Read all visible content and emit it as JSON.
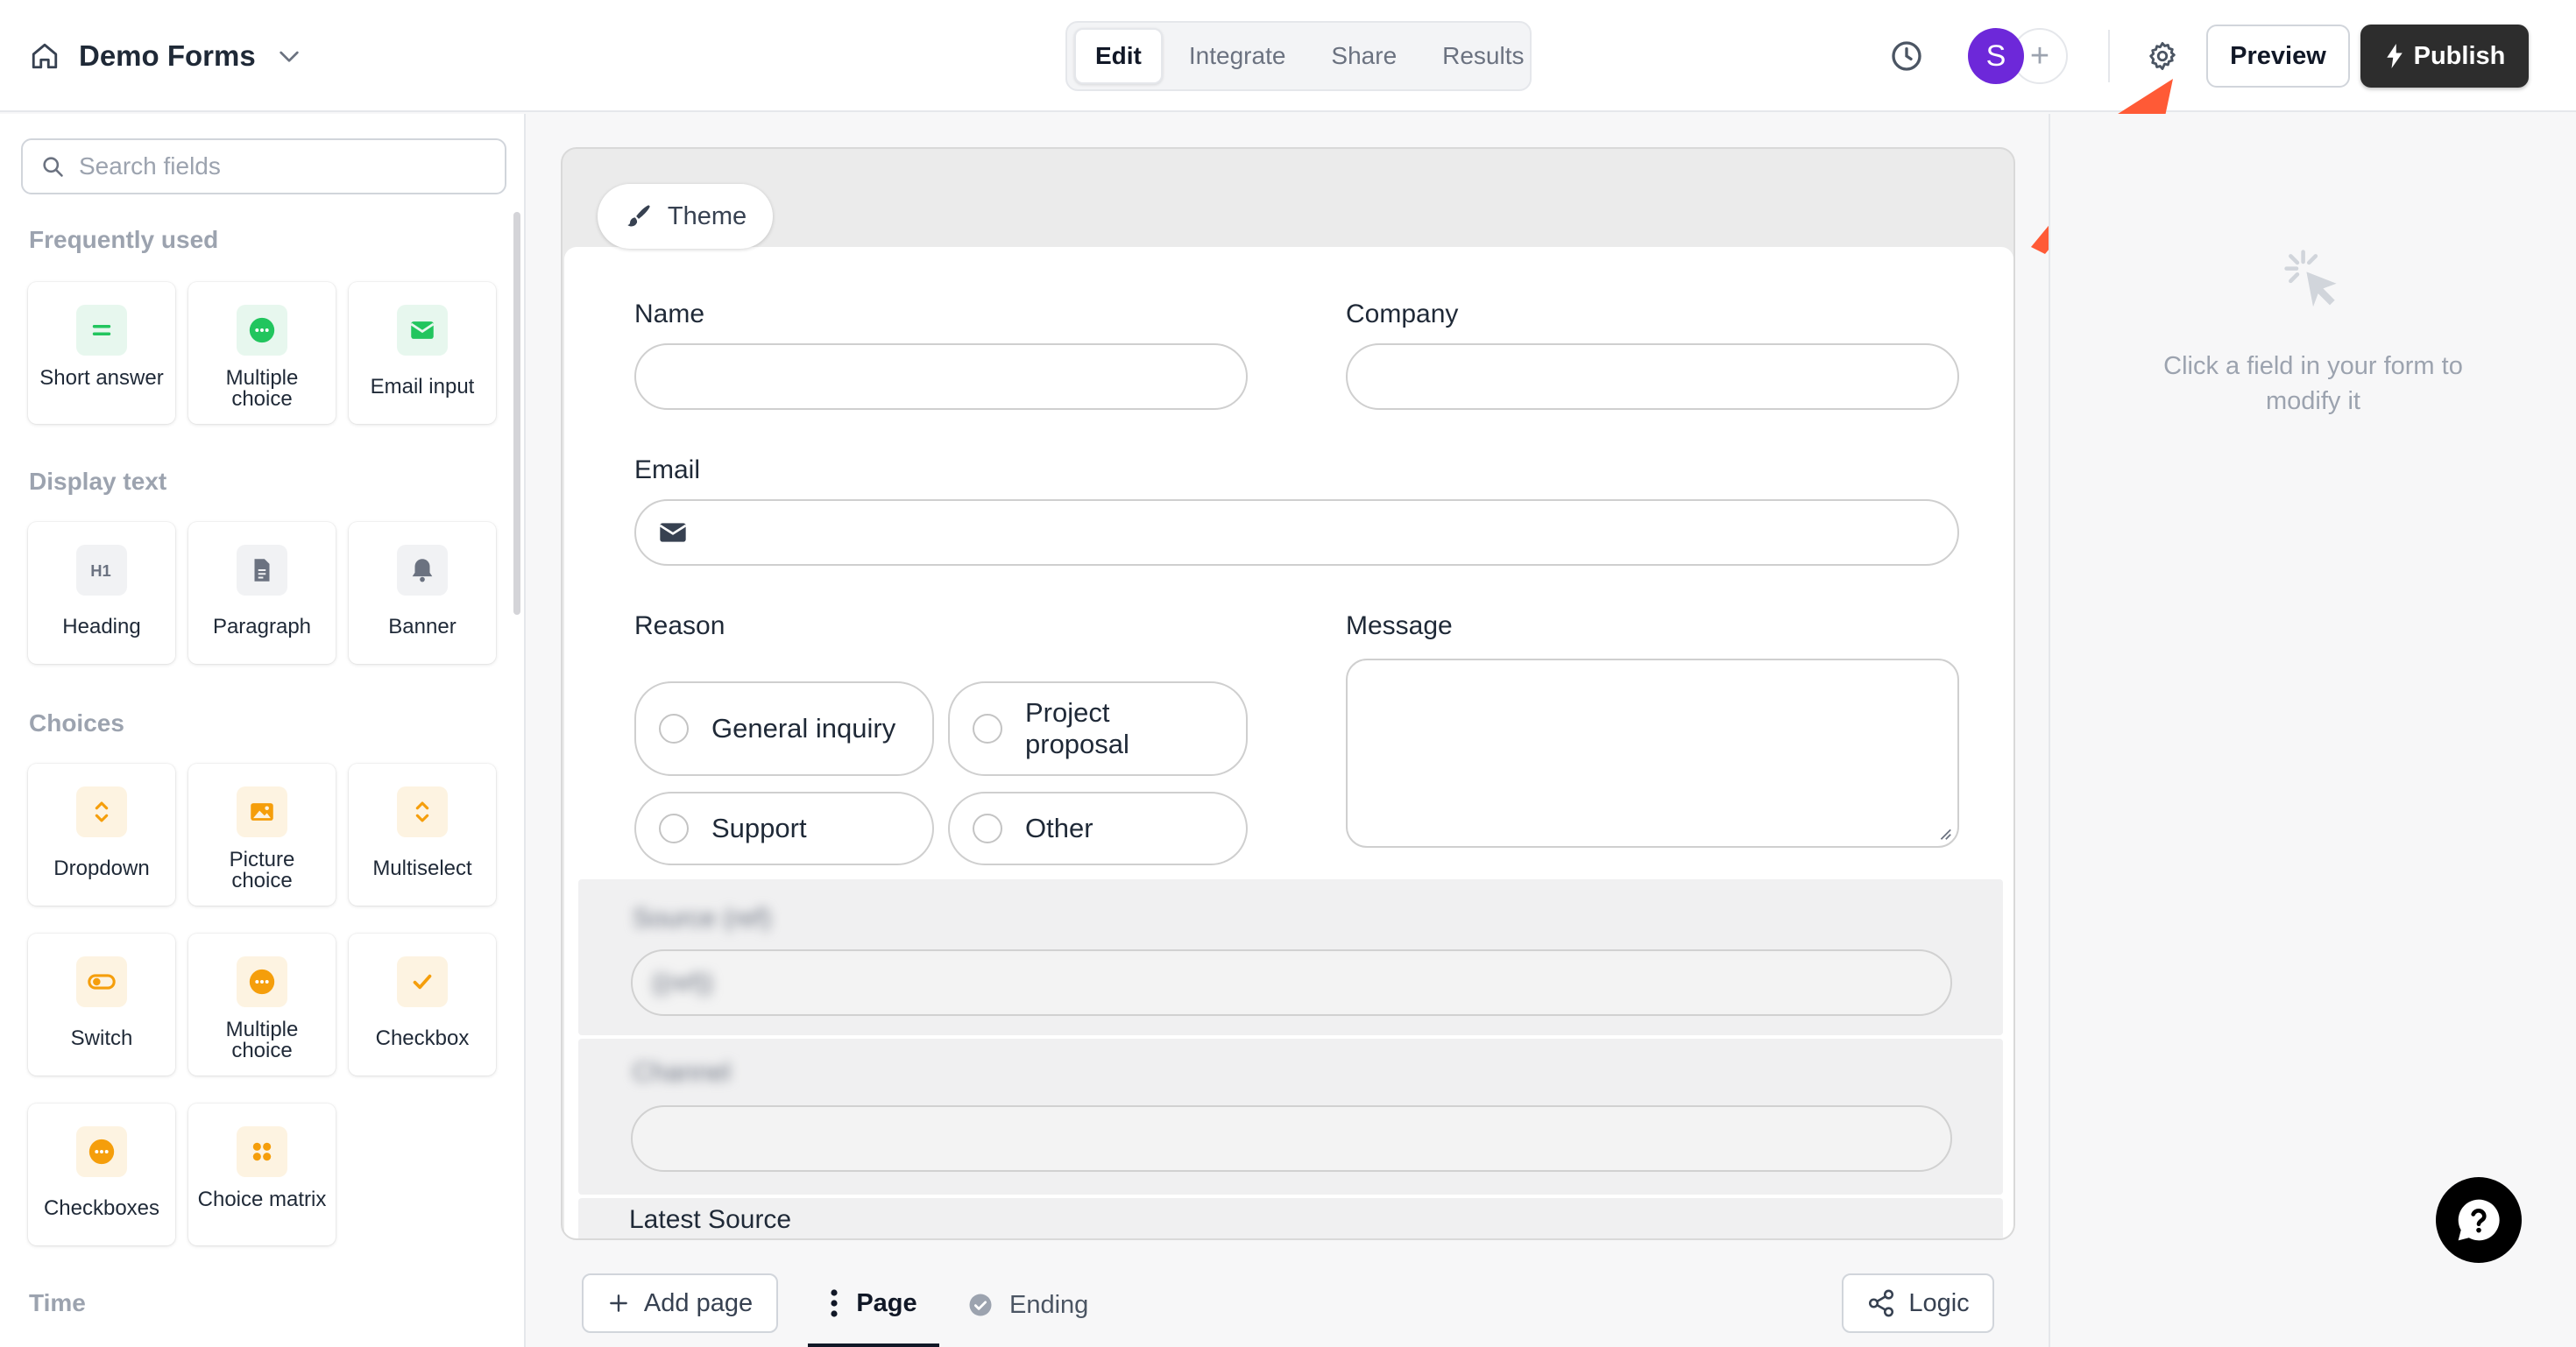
{
  "header": {
    "workspace_title": "Demo Forms",
    "tabs": [
      {
        "label": "Edit",
        "active": true
      },
      {
        "label": "Integrate",
        "active": false
      },
      {
        "label": "Share",
        "active": false
      },
      {
        "label": "Results",
        "active": false
      }
    ],
    "avatar_initial": "S",
    "add_member_symbol": "+",
    "preview_label": "Preview",
    "publish_label": "Publish"
  },
  "sidebar": {
    "search_placeholder": "Search fields",
    "sections": [
      {
        "title": "Frequently used",
        "items": [
          {
            "label": "Short answer",
            "icon": "equals-icon",
            "color": "green"
          },
          {
            "label": "Multiple choice",
            "icon": "dots-circle-icon",
            "color": "green"
          },
          {
            "label": "Email input",
            "icon": "envelope-icon",
            "color": "green"
          }
        ]
      },
      {
        "title": "Display text",
        "items": [
          {
            "label": "Heading",
            "icon": "h1-icon",
            "color": "gray"
          },
          {
            "label": "Paragraph",
            "icon": "document-icon",
            "color": "gray"
          },
          {
            "label": "Banner",
            "icon": "bell-icon",
            "color": "gray"
          }
        ]
      },
      {
        "title": "Choices",
        "items": [
          {
            "label": "Dropdown",
            "icon": "chevron-updown-icon",
            "color": "orange"
          },
          {
            "label": "Picture choice",
            "icon": "image-icon",
            "color": "orange"
          },
          {
            "label": "Multiselect",
            "icon": "chevron-updown-icon",
            "color": "orange"
          },
          {
            "label": "Switch",
            "icon": "toggle-icon",
            "color": "orange"
          },
          {
            "label": "Multiple choice",
            "icon": "dots-circle-icon",
            "color": "orange"
          },
          {
            "label": "Checkbox",
            "icon": "check-icon",
            "color": "orange"
          },
          {
            "label": "Checkboxes",
            "icon": "dots-circle-icon",
            "color": "orange"
          },
          {
            "label": "Choice matrix",
            "icon": "grid-icon",
            "color": "orange"
          }
        ]
      },
      {
        "title": "Time",
        "items": []
      }
    ]
  },
  "canvas": {
    "theme_label": "Theme",
    "fields": {
      "name_label": "Name",
      "company_label": "Company",
      "email_label": "Email",
      "reason_label": "Reason",
      "message_label": "Message",
      "reason_options": [
        "General inquiry",
        "Project proposal",
        "Support",
        "Other"
      ],
      "hidden_field_1_label": "Source (ref)",
      "hidden_field_1_value": "{{ref}}",
      "hidden_field_2_label": "Channel",
      "latest_source_label": "Latest Source"
    }
  },
  "bottom_bar": {
    "add_page_label": "Add page",
    "page_label": "Page",
    "ending_label": "Ending",
    "logic_label": "Logic"
  },
  "right_panel": {
    "hint": "Click a field in your form to modify it"
  },
  "colors": {
    "publish_bg": "#2d2d2d",
    "avatar_bg": "#6d28d9",
    "green_icon": "#22c55e",
    "orange_icon": "#f59e0b",
    "annotation_arrow": "#ff5a36"
  }
}
